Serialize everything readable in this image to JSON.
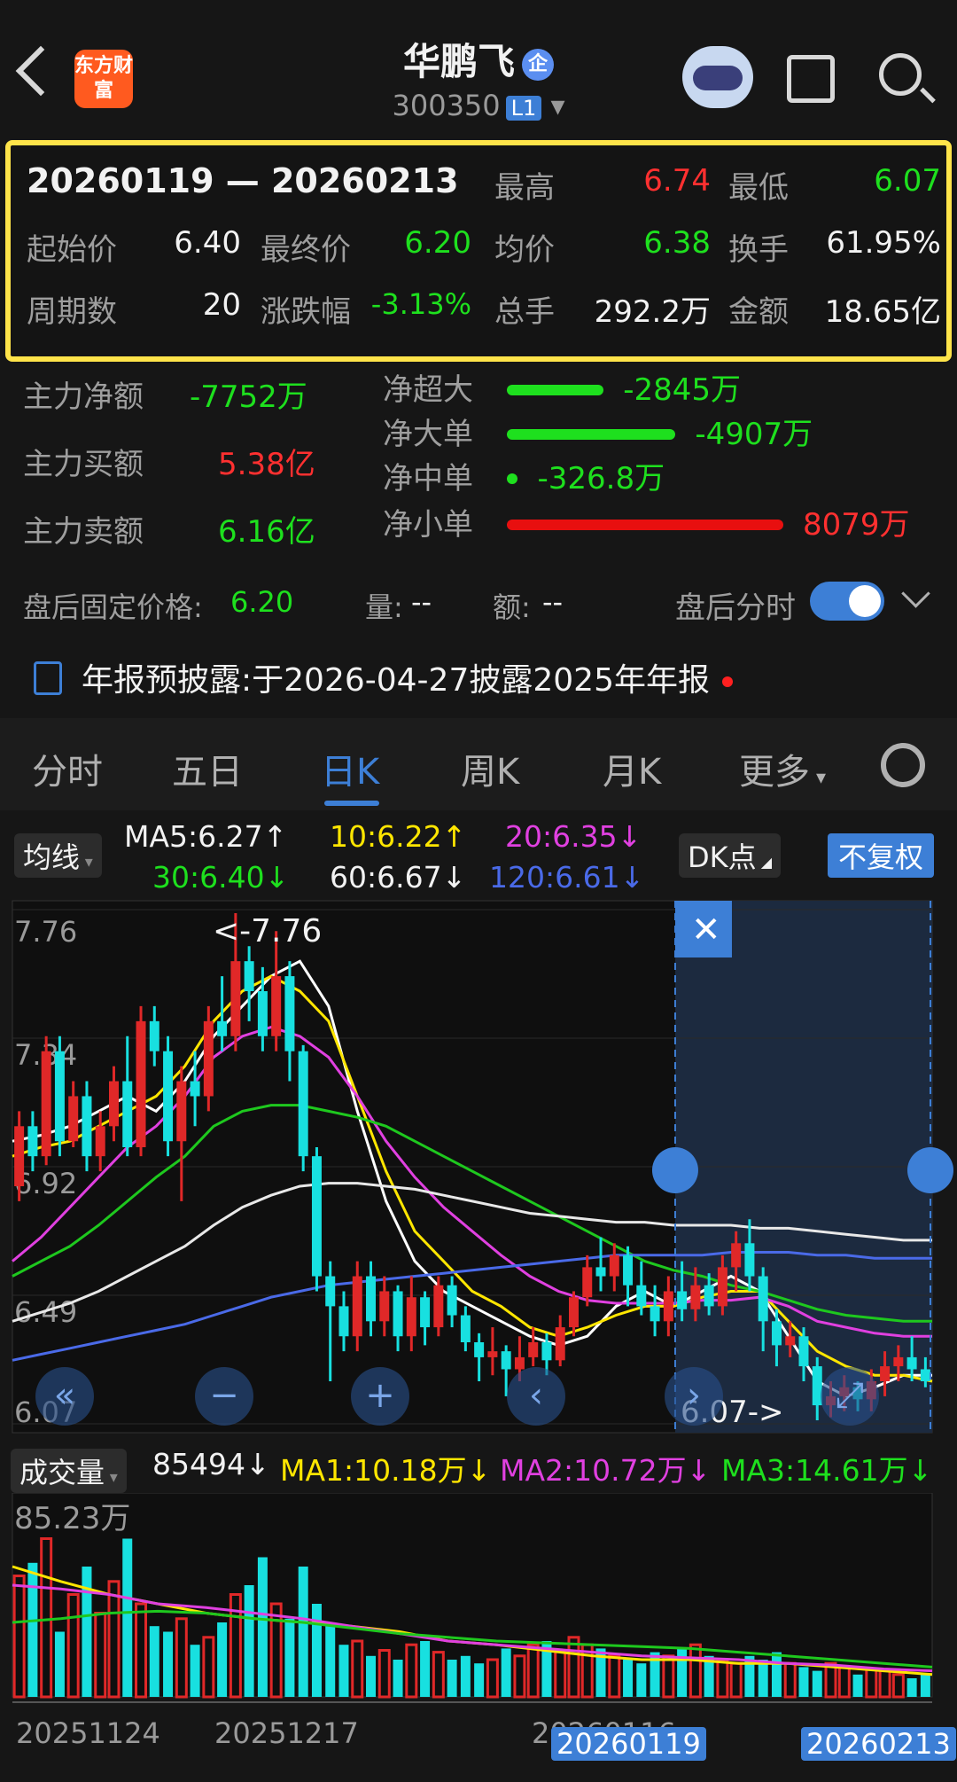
{
  "header": {
    "title": "华鹏飞",
    "title_badge": "企",
    "code": "300350",
    "level": "L1",
    "brand": "东方财富"
  },
  "summary": {
    "date_range": "20260119 — 20260213",
    "high_label": "最高",
    "high": "6.74",
    "low_label": "最低",
    "low": "6.07",
    "start_label": "起始价",
    "start": "6.40",
    "end_label": "最终价",
    "end": "6.20",
    "avg_label": "均价",
    "avg": "6.38",
    "turnover_label": "换手",
    "turnover": "61.95%",
    "periods_label": "周期数",
    "periods": "20",
    "change_label": "涨跌幅",
    "change": "-3.13%",
    "volume_label": "总手",
    "volume": "292.2万",
    "amount_label": "金额",
    "amount": "18.65亿"
  },
  "flows": {
    "main_net_label": "主力净额",
    "main_net": "-7752万",
    "main_buy_label": "主力买额",
    "main_buy": "5.38亿",
    "main_sell_label": "主力卖额",
    "main_sell": "6.16亿",
    "items": [
      {
        "label": "净超大",
        "value": "-2845万",
        "fraction": 0.35,
        "color": "#1ee01e"
      },
      {
        "label": "净大单",
        "value": "-4907万",
        "fraction": 0.61,
        "color": "#1ee01e"
      },
      {
        "label": "净中单",
        "value": "-326.8万",
        "fraction": 0.04,
        "color": "#1ee01e"
      },
      {
        "label": "净小单",
        "value": "8079万",
        "fraction": 1.0,
        "color": "#e80f0f"
      }
    ]
  },
  "after_hours": {
    "price_label": "盘后固定价格:",
    "price": "6.20",
    "vol_label": "量:",
    "vol": "--",
    "amt_label": "额:",
    "amt": "--",
    "toggle_label": "盘后分时"
  },
  "notice": {
    "label": "年报预披露:",
    "text": "于2026-04-27披露2025年年报"
  },
  "tabs": [
    "分时",
    "五日",
    "日K",
    "周K",
    "月K",
    "更多"
  ],
  "active_tab": 2,
  "ma": {
    "selector": "均线",
    "ma5": "MA5:6.27↑",
    "ma10": "10:6.22↑",
    "ma20": "20:6.35↓",
    "ma30": "30:6.40↓",
    "ma60": "60:6.67↓",
    "ma120": "120:6.61↓",
    "dk_button": "DK点",
    "fq_button": "不复权"
  },
  "volume_panel": {
    "selector": "成交量",
    "current": "85494↓",
    "ma1": "MA1:10.18万↓",
    "ma2": "MA2:10.72万↓",
    "ma3": "MA3:14.61万↓",
    "max_label": "85.23万"
  },
  "chart_data": {
    "type": "candlestick",
    "y_ticks": [
      "7.76",
      "7.34",
      "6.92",
      "6.49",
      "6.07"
    ],
    "ylim": [
      6.07,
      7.76
    ],
    "max_annotation": "<-7.76",
    "min_annotation": "6.07->",
    "x_ticks": [
      "20251124",
      "20251217",
      "20260116"
    ],
    "selection_start": "20260119",
    "selection_end": "20260213",
    "candles": [
      {
        "o": 6.85,
        "c": 7.05,
        "h": 7.1,
        "l": 6.8
      },
      {
        "o": 7.05,
        "c": 6.95,
        "h": 7.1,
        "l": 6.9
      },
      {
        "o": 6.95,
        "c": 7.3,
        "h": 7.35,
        "l": 6.92
      },
      {
        "o": 7.3,
        "c": 7.0,
        "h": 7.35,
        "l": 6.95
      },
      {
        "o": 7.0,
        "c": 7.15,
        "h": 7.2,
        "l": 6.98
      },
      {
        "o": 7.15,
        "c": 6.95,
        "h": 7.2,
        "l": 6.9
      },
      {
        "o": 6.95,
        "c": 7.05,
        "h": 7.1,
        "l": 6.9
      },
      {
        "o": 7.05,
        "c": 7.2,
        "h": 7.25,
        "l": 7.0
      },
      {
        "o": 7.2,
        "c": 6.98,
        "h": 7.35,
        "l": 6.95
      },
      {
        "o": 6.98,
        "c": 7.4,
        "h": 7.45,
        "l": 6.95
      },
      {
        "o": 7.4,
        "c": 7.3,
        "h": 7.45,
        "l": 7.25
      },
      {
        "o": 7.3,
        "c": 7.0,
        "h": 7.35,
        "l": 6.95
      },
      {
        "o": 7.0,
        "c": 7.2,
        "h": 7.25,
        "l": 6.8
      },
      {
        "o": 7.2,
        "c": 7.15,
        "h": 7.3,
        "l": 7.05
      },
      {
        "o": 7.15,
        "c": 7.4,
        "h": 7.45,
        "l": 7.1
      },
      {
        "o": 7.4,
        "c": 7.35,
        "h": 7.55,
        "l": 7.3
      },
      {
        "o": 7.35,
        "c": 7.6,
        "h": 7.76,
        "l": 7.3
      },
      {
        "o": 7.6,
        "c": 7.5,
        "h": 7.65,
        "l": 7.4
      },
      {
        "o": 7.5,
        "c": 7.35,
        "h": 7.58,
        "l": 7.3
      },
      {
        "o": 7.35,
        "c": 7.55,
        "h": 7.7,
        "l": 7.3
      },
      {
        "o": 7.55,
        "c": 7.3,
        "h": 7.6,
        "l": 7.2
      },
      {
        "o": 7.3,
        "c": 6.95,
        "h": 7.32,
        "l": 6.9
      },
      {
        "o": 6.95,
        "c": 6.55,
        "h": 6.98,
        "l": 6.5
      },
      {
        "o": 6.55,
        "c": 6.45,
        "h": 6.6,
        "l": 6.2
      },
      {
        "o": 6.45,
        "c": 6.35,
        "h": 6.5,
        "l": 6.3
      },
      {
        "o": 6.35,
        "c": 6.55,
        "h": 6.6,
        "l": 6.3
      },
      {
        "o": 6.55,
        "c": 6.4,
        "h": 6.6,
        "l": 6.35
      },
      {
        "o": 6.4,
        "c": 6.5,
        "h": 6.55,
        "l": 6.35
      },
      {
        "o": 6.5,
        "c": 6.35,
        "h": 6.52,
        "l": 6.3
      },
      {
        "o": 6.35,
        "c": 6.48,
        "h": 6.55,
        "l": 6.3
      },
      {
        "o": 6.48,
        "c": 6.38,
        "h": 6.5,
        "l": 6.32
      },
      {
        "o": 6.38,
        "c": 6.52,
        "h": 6.55,
        "l": 6.35
      },
      {
        "o": 6.52,
        "c": 6.42,
        "h": 6.55,
        "l": 6.38
      },
      {
        "o": 6.42,
        "c": 6.33,
        "h": 6.45,
        "l": 6.3
      },
      {
        "o": 6.33,
        "c": 6.28,
        "h": 6.36,
        "l": 6.2
      },
      {
        "o": 6.28,
        "c": 6.3,
        "h": 6.38,
        "l": 6.22
      },
      {
        "o": 6.3,
        "c": 6.24,
        "h": 6.32,
        "l": 6.15
      },
      {
        "o": 6.24,
        "c": 6.28,
        "h": 6.35,
        "l": 6.2
      },
      {
        "o": 6.28,
        "c": 6.33,
        "h": 6.38,
        "l": 6.25
      },
      {
        "o": 6.33,
        "c": 6.27,
        "h": 6.36,
        "l": 6.22
      },
      {
        "o": 6.27,
        "c": 6.38,
        "h": 6.42,
        "l": 6.25
      },
      {
        "o": 6.38,
        "c": 6.48,
        "h": 6.5,
        "l": 6.35
      },
      {
        "o": 6.48,
        "c": 6.58,
        "h": 6.62,
        "l": 6.45
      },
      {
        "o": 6.58,
        "c": 6.55,
        "h": 6.68,
        "l": 6.5
      },
      {
        "o": 6.55,
        "c": 6.62,
        "h": 6.66,
        "l": 6.5
      },
      {
        "o": 6.62,
        "c": 6.52,
        "h": 6.65,
        "l": 6.45
      },
      {
        "o": 6.52,
        "c": 6.45,
        "h": 6.6,
        "l": 6.42
      },
      {
        "o": 6.45,
        "c": 6.4,
        "h": 6.52,
        "l": 6.35
      },
      {
        "o": 6.4,
        "c": 6.5,
        "h": 6.55,
        "l": 6.35
      },
      {
        "o": 6.5,
        "c": 6.44,
        "h": 6.6,
        "l": 6.4
      },
      {
        "o": 6.44,
        "c": 6.52,
        "h": 6.58,
        "l": 6.4
      },
      {
        "o": 6.52,
        "c": 6.45,
        "h": 6.56,
        "l": 6.42
      },
      {
        "o": 6.45,
        "c": 6.58,
        "h": 6.62,
        "l": 6.42
      },
      {
        "o": 6.58,
        "c": 6.66,
        "h": 6.7,
        "l": 6.5
      },
      {
        "o": 6.66,
        "c": 6.55,
        "h": 6.74,
        "l": 6.5
      },
      {
        "o": 6.55,
        "c": 6.4,
        "h": 6.58,
        "l": 6.3
      },
      {
        "o": 6.4,
        "c": 6.32,
        "h": 6.44,
        "l": 6.25
      },
      {
        "o": 6.32,
        "c": 6.35,
        "h": 6.4,
        "l": 6.28
      },
      {
        "o": 6.35,
        "c": 6.25,
        "h": 6.38,
        "l": 6.2
      },
      {
        "o": 6.25,
        "c": 6.12,
        "h": 6.28,
        "l": 6.07
      },
      {
        "o": 6.12,
        "c": 6.15,
        "h": 6.2,
        "l": 6.08
      },
      {
        "o": 6.15,
        "c": 6.18,
        "h": 6.22,
        "l": 6.1
      },
      {
        "o": 6.18,
        "c": 6.14,
        "h": 6.2,
        "l": 6.1
      },
      {
        "o": 6.14,
        "c": 6.2,
        "h": 6.24,
        "l": 6.1
      },
      {
        "o": 6.2,
        "c": 6.25,
        "h": 6.3,
        "l": 6.15
      },
      {
        "o": 6.25,
        "c": 6.28,
        "h": 6.32,
        "l": 6.2
      },
      {
        "o": 6.28,
        "c": 6.24,
        "h": 6.35,
        "l": 6.2
      },
      {
        "o": 6.24,
        "c": 6.2,
        "h": 6.28,
        "l": 6.18
      }
    ],
    "ma_lines": [
      {
        "name": "MA5",
        "color": "#ffffff",
        "values": [
          7.0,
          7.02,
          7.05,
          7.1,
          7.15,
          7.1,
          7.2,
          7.35,
          7.45,
          7.55,
          7.6,
          7.45,
          7.1,
          6.8,
          6.6,
          6.5,
          6.45,
          6.4,
          6.35,
          6.32,
          6.35,
          6.45,
          6.5,
          6.45,
          6.5,
          6.55,
          6.5,
          6.35,
          6.2,
          6.15,
          6.18,
          6.22,
          6.22
        ]
      },
      {
        "name": "MA10",
        "color": "#ffe600",
        "values": [
          6.95,
          6.98,
          7.0,
          7.05,
          7.1,
          7.15,
          7.25,
          7.4,
          7.5,
          7.55,
          7.5,
          7.4,
          7.15,
          6.9,
          6.7,
          6.6,
          6.5,
          6.45,
          6.38,
          6.35,
          6.38,
          6.42,
          6.45,
          6.45,
          6.48,
          6.5,
          6.5,
          6.4,
          6.3,
          6.25,
          6.22,
          6.22,
          6.2
        ]
      },
      {
        "name": "MA20",
        "color": "#e040e0",
        "values": [
          6.6,
          6.68,
          6.78,
          6.88,
          6.98,
          7.05,
          7.15,
          7.28,
          7.35,
          7.38,
          7.35,
          7.28,
          7.15,
          7.0,
          6.88,
          6.78,
          6.7,
          6.62,
          6.55,
          6.5,
          6.47,
          6.46,
          6.46,
          6.46,
          6.47,
          6.47,
          6.48,
          6.45,
          6.4,
          6.38,
          6.36,
          6.35,
          6.35
        ]
      },
      {
        "name": "MA30",
        "color": "#1ec81e",
        "values": [
          6.55,
          6.6,
          6.65,
          6.72,
          6.8,
          6.88,
          6.95,
          7.05,
          7.1,
          7.12,
          7.12,
          7.1,
          7.08,
          7.05,
          7.0,
          6.95,
          6.9,
          6.85,
          6.8,
          6.75,
          6.7,
          6.65,
          6.6,
          6.57,
          6.55,
          6.52,
          6.5,
          6.47,
          6.44,
          6.42,
          6.41,
          6.4,
          6.4
        ]
      },
      {
        "name": "MA60",
        "color": "#e8e8e8",
        "values": [
          6.4,
          6.43,
          6.46,
          6.5,
          6.55,
          6.6,
          6.65,
          6.72,
          6.78,
          6.82,
          6.85,
          6.86,
          6.86,
          6.85,
          6.84,
          6.82,
          6.8,
          6.78,
          6.76,
          6.75,
          6.74,
          6.73,
          6.73,
          6.72,
          6.72,
          6.72,
          6.71,
          6.71,
          6.7,
          6.69,
          6.68,
          6.67,
          6.67
        ]
      },
      {
        "name": "MA120",
        "color": "#4a6ae8",
        "values": [
          6.27,
          6.29,
          6.31,
          6.33,
          6.35,
          6.37,
          6.39,
          6.42,
          6.45,
          6.48,
          6.5,
          6.52,
          6.53,
          6.54,
          6.55,
          6.56,
          6.57,
          6.58,
          6.59,
          6.6,
          6.61,
          6.62,
          6.62,
          6.62,
          6.62,
          6.63,
          6.63,
          6.63,
          6.62,
          6.62,
          6.61,
          6.61,
          6.61
        ]
      }
    ],
    "volume": [
      0.65,
      0.72,
      0.85,
      0.35,
      0.55,
      0.7,
      0.45,
      0.62,
      0.85,
      0.5,
      0.38,
      0.35,
      0.42,
      0.28,
      0.32,
      0.4,
      0.55,
      0.6,
      0.75,
      0.5,
      0.42,
      0.7,
      0.5,
      0.38,
      0.28,
      0.3,
      0.22,
      0.25,
      0.2,
      0.28,
      0.3,
      0.24,
      0.2,
      0.22,
      0.18,
      0.2,
      0.26,
      0.22,
      0.28,
      0.3,
      0.25,
      0.32,
      0.28,
      0.26,
      0.22,
      0.2,
      0.18,
      0.24,
      0.22,
      0.26,
      0.28,
      0.22,
      0.2,
      0.18,
      0.22,
      0.2,
      0.24,
      0.18,
      0.16,
      0.14,
      0.18,
      0.16,
      0.12,
      0.15,
      0.14,
      0.12,
      0.1,
      0.12
    ],
    "volume_ylim": [
      0,
      85.23
    ]
  }
}
